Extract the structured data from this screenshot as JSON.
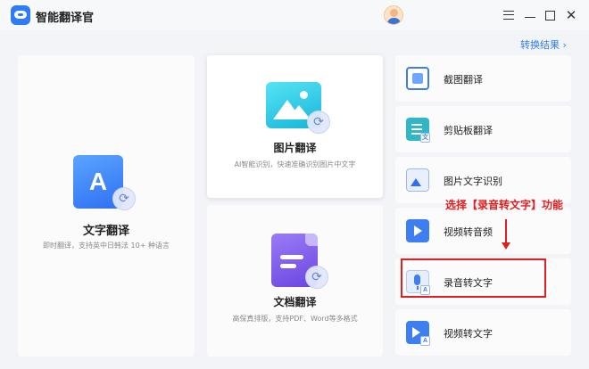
{
  "app": {
    "title": "智能翻译官"
  },
  "header": {
    "results_link": "转换结果 ›"
  },
  "cards": {
    "text": {
      "title": "文字翻译",
      "desc": "即时翻译，支持英中日韩法 10+ 种语言",
      "icon_glyph": "A"
    },
    "image": {
      "title": "图片翻译",
      "desc": "AI智能识别，快速准确识别图片中文字"
    },
    "doc": {
      "title": "文档翻译",
      "desc": "高保真排版，支持PDF、Word等多格式"
    }
  },
  "tools": [
    {
      "label": "截图翻译",
      "icon": "screenshot-translate-icon"
    },
    {
      "label": "剪贴板翻译",
      "icon": "clipboard-icon"
    },
    {
      "label": "图片文字识别",
      "icon": "image-ocr-icon"
    },
    {
      "label": "视频转音频",
      "icon": "video-icon"
    },
    {
      "label": "录音转文字",
      "icon": "microphone-icon"
    },
    {
      "label": "视频转文字",
      "icon": "video-to-text-icon"
    }
  ],
  "annotation": {
    "text": "选择【录音转文字】功能",
    "color": "#e02020"
  },
  "badges": {
    "text": "A",
    "doc": "文"
  },
  "colors": {
    "accent": "#2f7cf6",
    "highlight": "#e02020"
  }
}
